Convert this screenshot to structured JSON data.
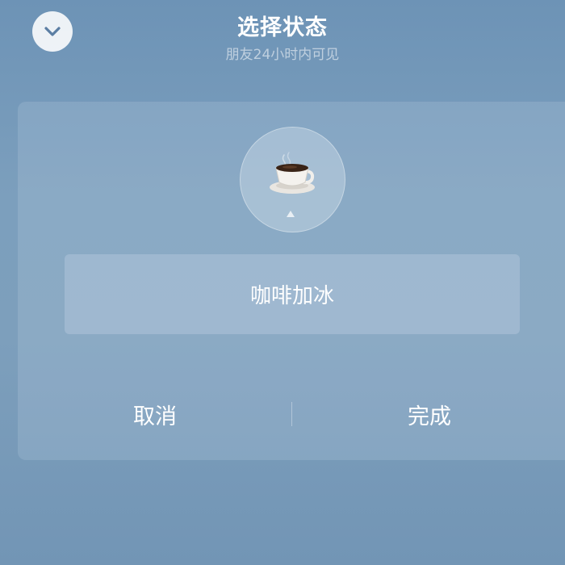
{
  "header": {
    "title": "选择状态",
    "subtitle": "朋友24小时内可见"
  },
  "collapse_button": {
    "icon": "chevron-down-icon",
    "icon_color": "#5b7ea3"
  },
  "status": {
    "emoji": "coffee-cup-icon",
    "text": "咖啡加冰"
  },
  "actions": {
    "cancel_label": "取消",
    "done_label": "完成"
  },
  "colors": {
    "background_top": "#6d93b6",
    "background_bottom": "#7295b5",
    "text": "#ffffff"
  }
}
